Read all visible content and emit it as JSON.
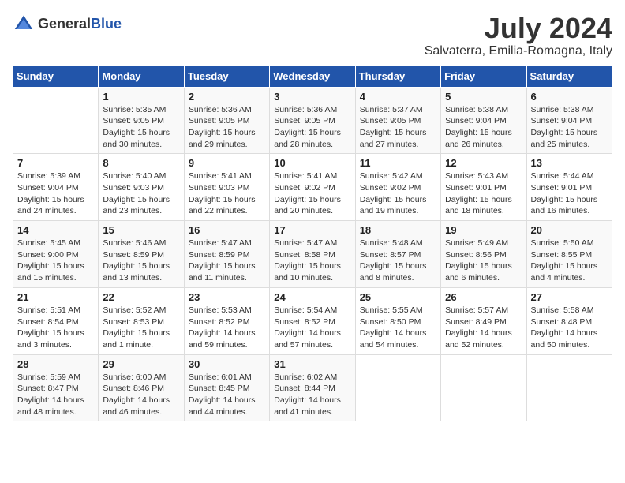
{
  "logo": {
    "general": "General",
    "blue": "Blue"
  },
  "title": "July 2024",
  "subtitle": "Salvaterra, Emilia-Romagna, Italy",
  "days_header": [
    "Sunday",
    "Monday",
    "Tuesday",
    "Wednesday",
    "Thursday",
    "Friday",
    "Saturday"
  ],
  "weeks": [
    [
      {
        "num": "",
        "info": ""
      },
      {
        "num": "1",
        "info": "Sunrise: 5:35 AM\nSunset: 9:05 PM\nDaylight: 15 hours\nand 30 minutes."
      },
      {
        "num": "2",
        "info": "Sunrise: 5:36 AM\nSunset: 9:05 PM\nDaylight: 15 hours\nand 29 minutes."
      },
      {
        "num": "3",
        "info": "Sunrise: 5:36 AM\nSunset: 9:05 PM\nDaylight: 15 hours\nand 28 minutes."
      },
      {
        "num": "4",
        "info": "Sunrise: 5:37 AM\nSunset: 9:05 PM\nDaylight: 15 hours\nand 27 minutes."
      },
      {
        "num": "5",
        "info": "Sunrise: 5:38 AM\nSunset: 9:04 PM\nDaylight: 15 hours\nand 26 minutes."
      },
      {
        "num": "6",
        "info": "Sunrise: 5:38 AM\nSunset: 9:04 PM\nDaylight: 15 hours\nand 25 minutes."
      }
    ],
    [
      {
        "num": "7",
        "info": "Sunrise: 5:39 AM\nSunset: 9:04 PM\nDaylight: 15 hours\nand 24 minutes."
      },
      {
        "num": "8",
        "info": "Sunrise: 5:40 AM\nSunset: 9:03 PM\nDaylight: 15 hours\nand 23 minutes."
      },
      {
        "num": "9",
        "info": "Sunrise: 5:41 AM\nSunset: 9:03 PM\nDaylight: 15 hours\nand 22 minutes."
      },
      {
        "num": "10",
        "info": "Sunrise: 5:41 AM\nSunset: 9:02 PM\nDaylight: 15 hours\nand 20 minutes."
      },
      {
        "num": "11",
        "info": "Sunrise: 5:42 AM\nSunset: 9:02 PM\nDaylight: 15 hours\nand 19 minutes."
      },
      {
        "num": "12",
        "info": "Sunrise: 5:43 AM\nSunset: 9:01 PM\nDaylight: 15 hours\nand 18 minutes."
      },
      {
        "num": "13",
        "info": "Sunrise: 5:44 AM\nSunset: 9:01 PM\nDaylight: 15 hours\nand 16 minutes."
      }
    ],
    [
      {
        "num": "14",
        "info": "Sunrise: 5:45 AM\nSunset: 9:00 PM\nDaylight: 15 hours\nand 15 minutes."
      },
      {
        "num": "15",
        "info": "Sunrise: 5:46 AM\nSunset: 8:59 PM\nDaylight: 15 hours\nand 13 minutes."
      },
      {
        "num": "16",
        "info": "Sunrise: 5:47 AM\nSunset: 8:59 PM\nDaylight: 15 hours\nand 11 minutes."
      },
      {
        "num": "17",
        "info": "Sunrise: 5:47 AM\nSunset: 8:58 PM\nDaylight: 15 hours\nand 10 minutes."
      },
      {
        "num": "18",
        "info": "Sunrise: 5:48 AM\nSunset: 8:57 PM\nDaylight: 15 hours\nand 8 minutes."
      },
      {
        "num": "19",
        "info": "Sunrise: 5:49 AM\nSunset: 8:56 PM\nDaylight: 15 hours\nand 6 minutes."
      },
      {
        "num": "20",
        "info": "Sunrise: 5:50 AM\nSunset: 8:55 PM\nDaylight: 15 hours\nand 4 minutes."
      }
    ],
    [
      {
        "num": "21",
        "info": "Sunrise: 5:51 AM\nSunset: 8:54 PM\nDaylight: 15 hours\nand 3 minutes."
      },
      {
        "num": "22",
        "info": "Sunrise: 5:52 AM\nSunset: 8:53 PM\nDaylight: 15 hours\nand 1 minute."
      },
      {
        "num": "23",
        "info": "Sunrise: 5:53 AM\nSunset: 8:52 PM\nDaylight: 14 hours\nand 59 minutes."
      },
      {
        "num": "24",
        "info": "Sunrise: 5:54 AM\nSunset: 8:52 PM\nDaylight: 14 hours\nand 57 minutes."
      },
      {
        "num": "25",
        "info": "Sunrise: 5:55 AM\nSunset: 8:50 PM\nDaylight: 14 hours\nand 54 minutes."
      },
      {
        "num": "26",
        "info": "Sunrise: 5:57 AM\nSunset: 8:49 PM\nDaylight: 14 hours\nand 52 minutes."
      },
      {
        "num": "27",
        "info": "Sunrise: 5:58 AM\nSunset: 8:48 PM\nDaylight: 14 hours\nand 50 minutes."
      }
    ],
    [
      {
        "num": "28",
        "info": "Sunrise: 5:59 AM\nSunset: 8:47 PM\nDaylight: 14 hours\nand 48 minutes."
      },
      {
        "num": "29",
        "info": "Sunrise: 6:00 AM\nSunset: 8:46 PM\nDaylight: 14 hours\nand 46 minutes."
      },
      {
        "num": "30",
        "info": "Sunrise: 6:01 AM\nSunset: 8:45 PM\nDaylight: 14 hours\nand 44 minutes."
      },
      {
        "num": "31",
        "info": "Sunrise: 6:02 AM\nSunset: 8:44 PM\nDaylight: 14 hours\nand 41 minutes."
      },
      {
        "num": "",
        "info": ""
      },
      {
        "num": "",
        "info": ""
      },
      {
        "num": "",
        "info": ""
      }
    ]
  ]
}
